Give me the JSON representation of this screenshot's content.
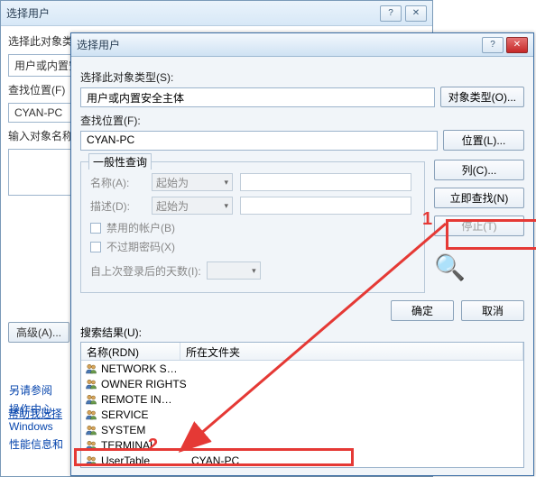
{
  "back": {
    "title": "选择用户",
    "labels": {
      "object_type": "选择此对象类型",
      "principal": "用户或内置安全",
      "location": "查找位置(F)",
      "location_value": "CYAN-PC",
      "enter_names": "输入对象名称",
      "advanced": "高级(A)..."
    },
    "help_link": "帮助我选择"
  },
  "front": {
    "title": "选择用户",
    "labels": {
      "object_type": "选择此对象类型(S):",
      "principal": "用户或内置安全主体",
      "object_type_btn": "对象类型(O)...",
      "location": "查找位置(F):",
      "location_value": "CYAN-PC",
      "location_btn": "位置(L)...",
      "group_title": "一般性查询",
      "name": "名称(A):",
      "desc": "描述(D):",
      "starts_with": "起始为",
      "disabled_acct": "禁用的帐户(B)",
      "no_pwd_expire": "不过期密码(X)",
      "days_since_login": "自上次登录后的天数(I):",
      "columns_btn": "列(C)...",
      "find_now_btn": "立即查找(N)",
      "stop_btn": "停止(T)",
      "ok": "确定",
      "cancel": "取消",
      "results": "搜索结果(U):",
      "col_name": "名称(RDN)",
      "col_folder": "所在文件夹"
    },
    "results": [
      {
        "name": "NETWORK S…",
        "folder": ""
      },
      {
        "name": "OWNER RIGHTS",
        "folder": ""
      },
      {
        "name": "REMOTE IN…",
        "folder": ""
      },
      {
        "name": "SERVICE",
        "folder": ""
      },
      {
        "name": "SYSTEM",
        "folder": ""
      },
      {
        "name": "TERMINAL",
        "folder": ""
      },
      {
        "name": "UserTable",
        "folder": "CYAN-PC"
      }
    ]
  },
  "side_links": {
    "see_also": "另请参阅",
    "action_center": "操作中心",
    "windows": "Windows",
    "perf": "性能信息和"
  },
  "annotations": {
    "one": "1",
    "two": "2"
  }
}
